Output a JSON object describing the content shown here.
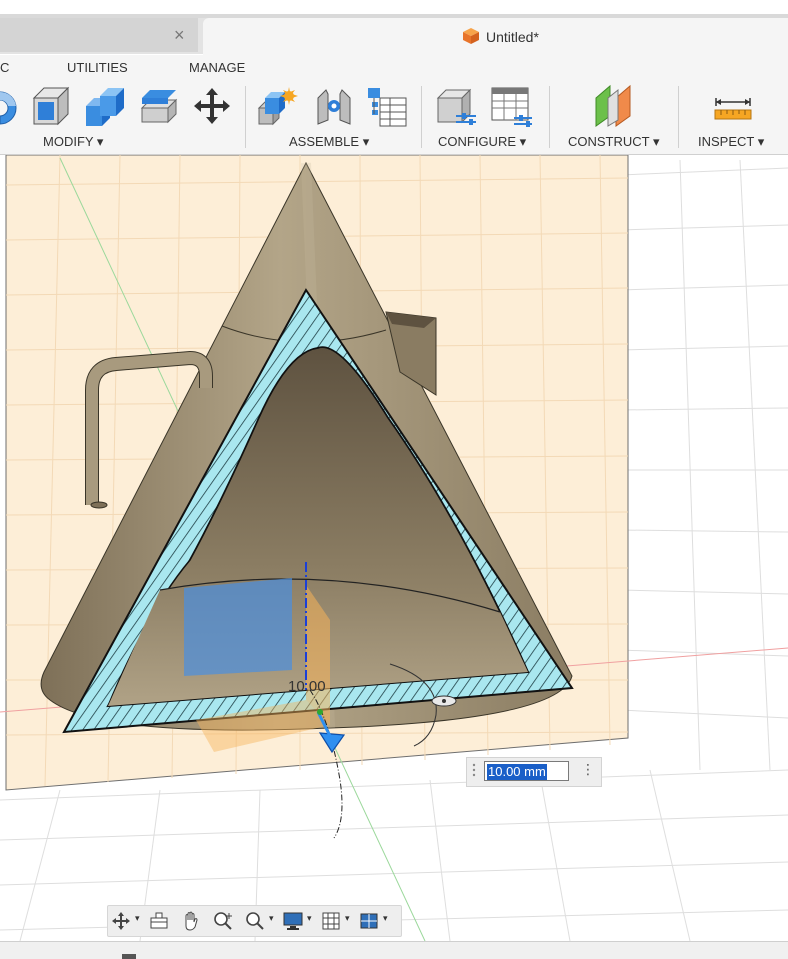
{
  "tabs": {
    "other_tab_close": "×",
    "active_tab_title": "Untitled*"
  },
  "ribbon": {
    "menu_tabs": [
      "C",
      "UTILITIES",
      "MANAGE"
    ],
    "groups": {
      "modify": "MODIFY ▾",
      "assemble": "ASSEMBLE ▾",
      "configure": "CONFIGURE ▾",
      "construct": "CONSTRUCT ▾",
      "inspect": "INSPECT ▾"
    }
  },
  "viewport": {
    "dimension_label": "10.00",
    "dimension_input_value": "10.00 mm",
    "dimension_more": "⋮"
  },
  "nav_toolbar": {
    "icons": [
      "orbit-icon",
      "look-at-icon",
      "pan-icon",
      "zoom-icon",
      "zoom-window-icon",
      "display-settings-icon",
      "grid-settings-icon",
      "viewports-icon"
    ]
  },
  "colors": {
    "accent_blue": "#1a5fc8",
    "model_body": "#a89a7e",
    "section_hatch": "#a8e6ee",
    "sketch_plane": "#fdeed7"
  }
}
